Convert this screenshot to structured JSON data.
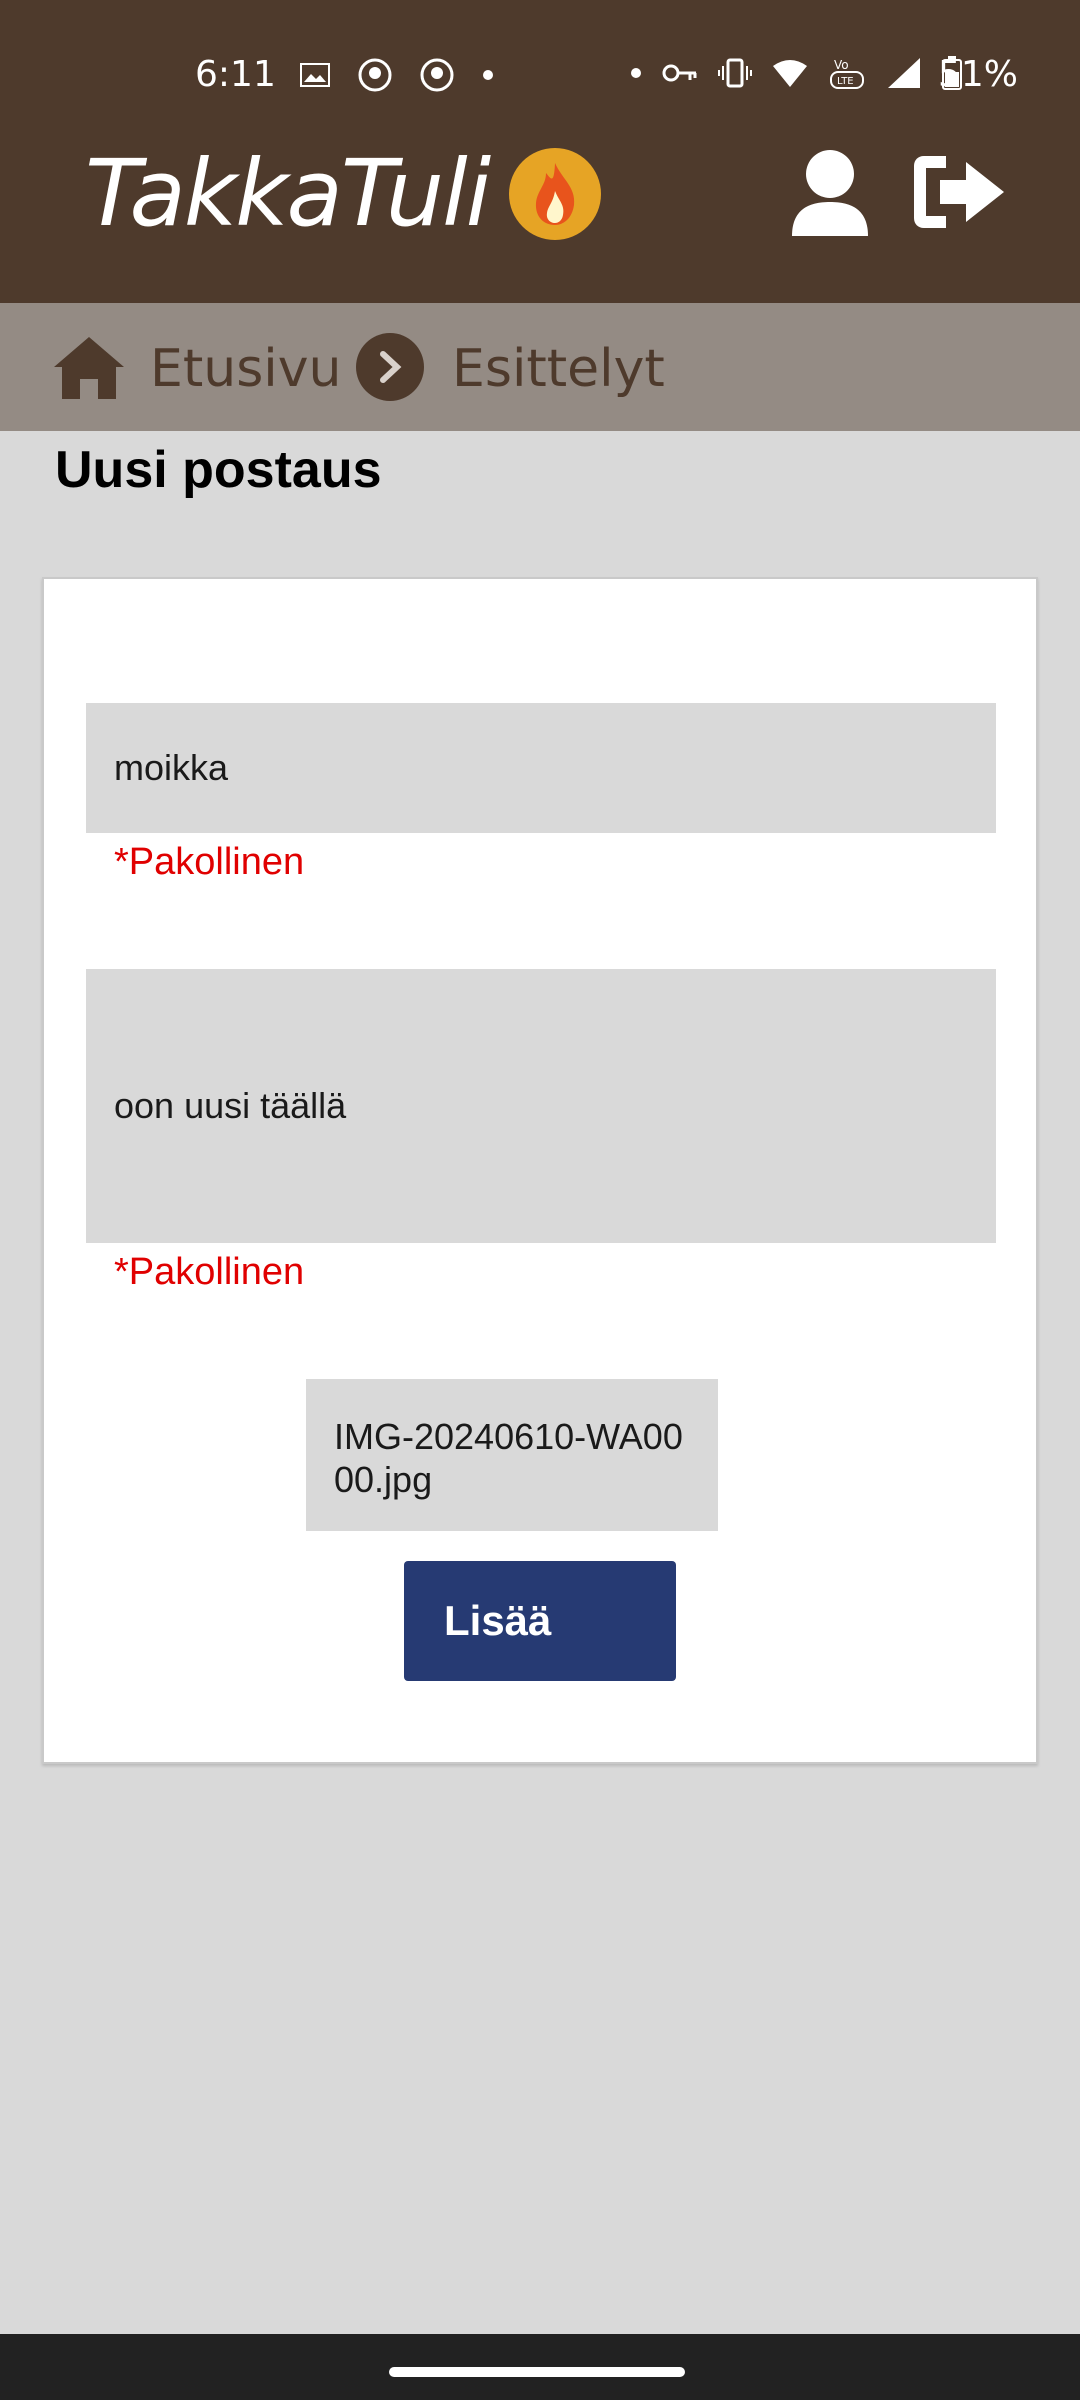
{
  "status_bar": {
    "time": "6:11",
    "battery": "51%",
    "left_icons": [
      "image-icon",
      "app-notification-icon",
      "app-notification-icon",
      "dot-icon"
    ],
    "right_icons": [
      "dot-icon",
      "vpn-key-icon",
      "vibrate-icon",
      "wifi-icon",
      "volte-icon",
      "signal-icon",
      "battery-icon"
    ]
  },
  "header": {
    "logo_text": "TakkaTuli",
    "logo_icon": "flame-icon",
    "colors": {
      "background": "#4e3a2c",
      "flame": "#e6a425"
    }
  },
  "breadcrumb": {
    "home_label": "Etusivu",
    "current_label": "Esittelyt"
  },
  "page": {
    "title": "Uusi postaus"
  },
  "form": {
    "title_value": "moikka",
    "title_required": "*Pakollinen",
    "body_value": "oon uusi täällä",
    "body_required": "*Pakollinen",
    "file_name": "IMG-20240610-WA0000.jpg",
    "submit_label": "Lisää",
    "colors": {
      "required": "#e00000",
      "button": "#263a73"
    }
  }
}
